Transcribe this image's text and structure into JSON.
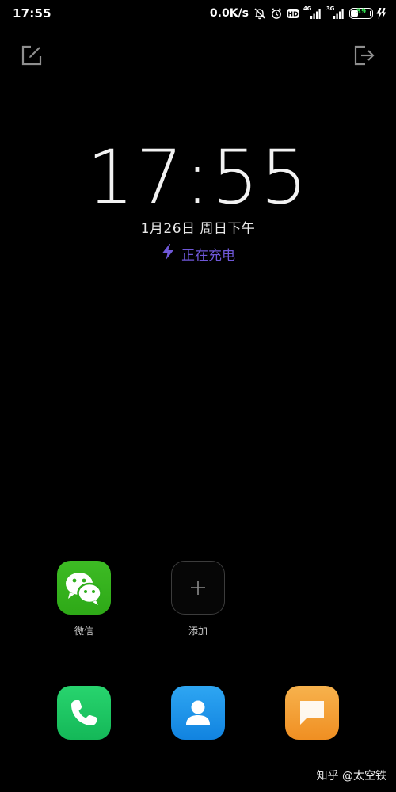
{
  "status_bar": {
    "time": "17:55",
    "net_speed": "0.0K/s",
    "signal1_label": "4G",
    "signal2_label": "3G",
    "battery_level": "39",
    "battery_fraction": 0.39,
    "icons": [
      "bell-off-icon",
      "alarm-icon",
      "hd-icon",
      "signal-4g-icon",
      "signal-3g-icon",
      "battery-icon",
      "charging-bolt-icon"
    ]
  },
  "top_actions": {
    "left_icon": "edit-icon",
    "right_icon": "exit-icon"
  },
  "lock": {
    "time": "17:55",
    "date": "1月26日 周日下午",
    "charging": "正在充电",
    "charging_color": "#6f58d8"
  },
  "shortcuts": [
    {
      "label": "微信",
      "icon": "wechat-icon",
      "color": "#2fae1c"
    },
    {
      "label": "添加",
      "icon": "plus-icon"
    }
  ],
  "dock": [
    {
      "icon": "phone-icon",
      "color": "#1cc463"
    },
    {
      "icon": "contacts-icon",
      "color": "#1f93e8"
    },
    {
      "icon": "messages-icon",
      "color": "#f4a03a"
    }
  ],
  "watermark": "知乎 @太空铁"
}
